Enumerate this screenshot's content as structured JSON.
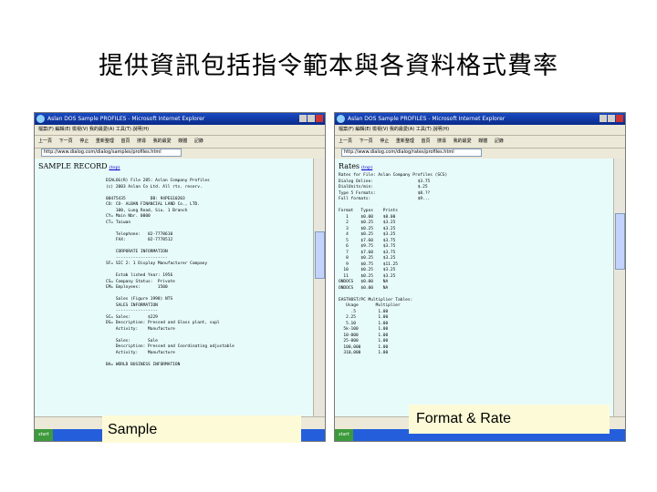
{
  "slide": {
    "title": "提供資訊包括指令範本與各資料格式費率"
  },
  "screenshots": [
    {
      "window_title": "Aslan DOS Sample PROFILES - Microsoft Internet Explorer",
      "menu": "檔案(F)  編輯(E)  檢視(V)  我的最愛(A)  工具(T)  說明(H)",
      "toolbar": [
        "上一頁",
        "下一頁",
        "停止",
        "重新整理",
        "首頁",
        "搜尋",
        "我的最愛",
        "媒體",
        "記錄"
      ],
      "address": "http://www.dialog.com/dialog/samples/profiles.html",
      "page_heading": "SAMPLE RECORD",
      "heading_link": "(top)",
      "body_lines": [
        "DIALOG(R) File 285: Aslan Company Profiles",
        "(c) 2003 Aslan Co Ltd. All rts. reserv.",
        "",
        "00475435          DB: 94PEG10203",
        "CO: CO- ALBAN FINANCIAL LAND Co., LTD.",
        "    100, Lung Road, Siu. 1 Branch",
        "CY= Main Nbr. 0000",
        "CT= Taiwan",
        "",
        "    Telephone:   02-7778610",
        "    FAX:         02-7778512",
        "",
        "    CORPORATE INFORMATION",
        "    ---------------------",
        "SF= SIC 2: 1 Display Manufacturer Company",
        "",
        "    Estab lished Year: 1956",
        "CS= Company Status:  Private",
        "EM= Employees:       1500",
        "",
        "    Sales (Figure 1998) NTS",
        "    SALES INFORMATION",
        "    -----------------",
        "SC= Sales:       $229",
        "DS= Description: Pressed and Glass plant, supl",
        "    Activity:    Manufacture",
        "",
        "    Sales:       Sale",
        "    Description: Pressed and Coordinating adjustable",
        "    Activity:    Manufacture",
        "",
        "BA= WORLD BUSINESS INFORMATION"
      ],
      "caption": "Sample"
    },
    {
      "window_title": "Aslan DOS Sample PROFILES - Microsoft Internet Explorer",
      "menu": "檔案(F)  編輯(E)  檢視(V)  我的最愛(A)  工具(T)  說明(H)",
      "toolbar": [
        "上一頁",
        "下一頁",
        "停止",
        "重新整理",
        "首頁",
        "搜尋",
        "我的最愛",
        "媒體",
        "記錄"
      ],
      "address": "http://www.dialog.com/dialog/rates/profiles.html",
      "page_heading": "Rates",
      "heading_link": "(top)",
      "body_lines": [
        "Rates for File: Aslan Company Profiles (SCS)",
        "Dialog Online:                  $3.75",
        "DialUnits/min:                  $.25",
        "Type 5 Formats:                 $8.??",
        "Full formats:                   $9...",
        "",
        "Format   Typos    Prints",
        "   1     $0.00    $0.00",
        "   2     $0.25    $3.25",
        "   3     $0.25    $3.25",
        "   4     $0.25    $3.25",
        "   5     $7.60    $3.75",
        "   6     $9.75    $3.75",
        "   7     $7.60    $3.75",
        "   8     $0.25    $3.25",
        "   9     $0.75    $11.25",
        "  10     $0.25    $3.25",
        "  11     $0.25    $3.25",
        "ONDOCS   $0.00    NA",
        "ONDOCS   $0.00    NA",
        "",
        "EASTHOST/PC Multiplier Tables:",
        "   Usage       Multiplier",
        "     .5         1.00",
        "   2.25         1.00",
        "   5.10         1.00",
        "  5k-100        1.00",
        "  10-000        1.00",
        "  25-000        1.00",
        "  100,000       1.00",
        "  310,000       1.00"
      ],
      "caption": "Format & Rate"
    }
  ]
}
